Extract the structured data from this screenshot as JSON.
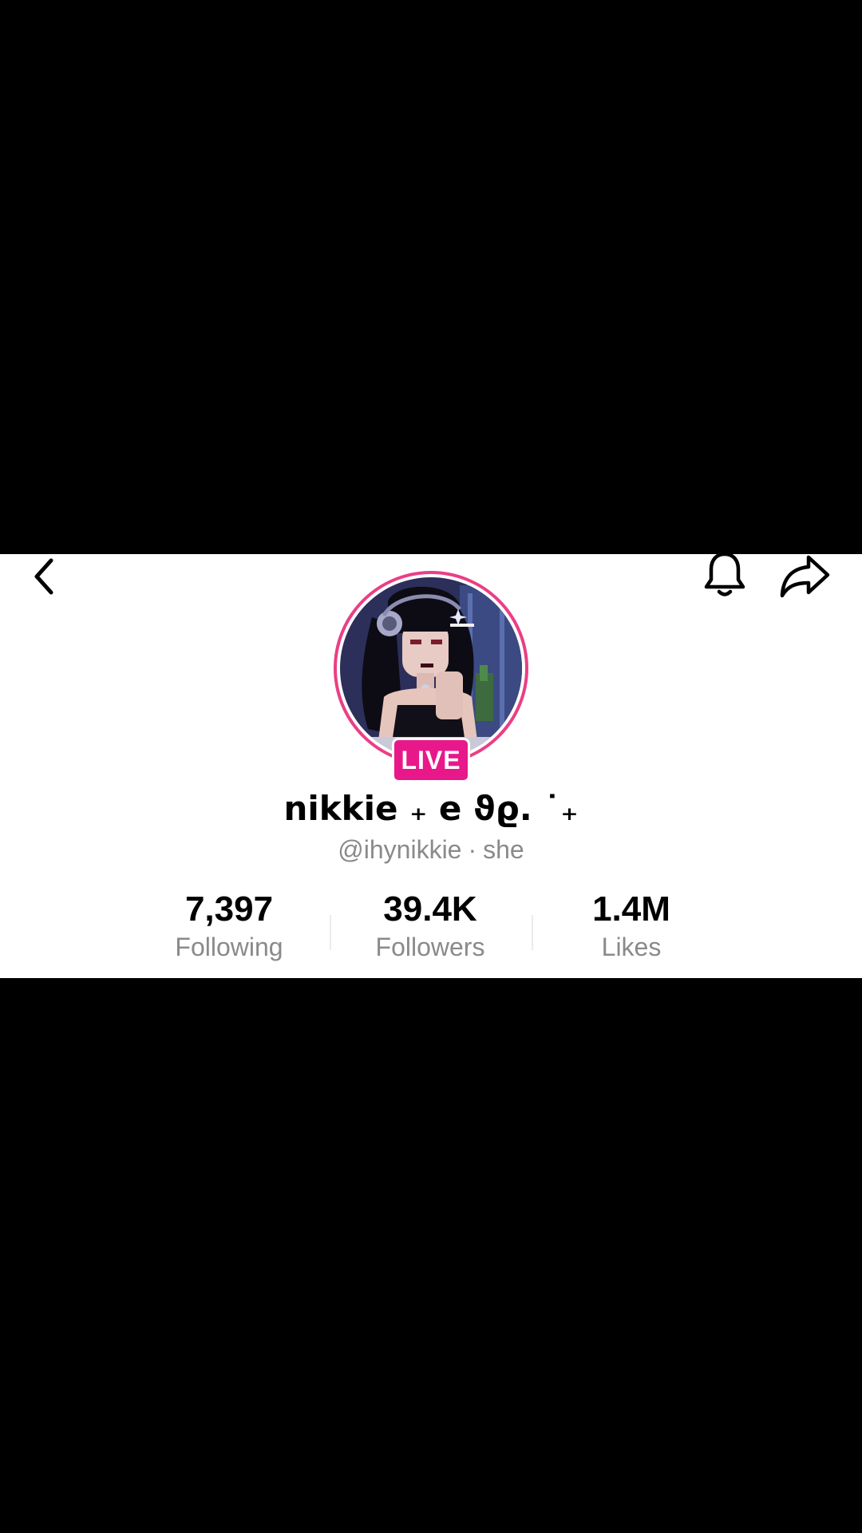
{
  "header": {
    "back_icon": "chevron-left-icon",
    "bell_icon": "bell-icon",
    "share_icon": "share-icon"
  },
  "profile": {
    "live_label": "LIVE",
    "display_name": "nikkie ₊ e ϑϱ. ˙₊",
    "handle": "@ihynikkie",
    "separator": "·",
    "pronouns": "she",
    "ring_color": "#ea3f85",
    "live_color": "#e8188a"
  },
  "stats": {
    "following": {
      "value": "7,397",
      "label": "Following"
    },
    "followers": {
      "value": "39.4K",
      "label": "Followers"
    },
    "likes": {
      "value": "1.4M",
      "label": "Likes"
    }
  }
}
